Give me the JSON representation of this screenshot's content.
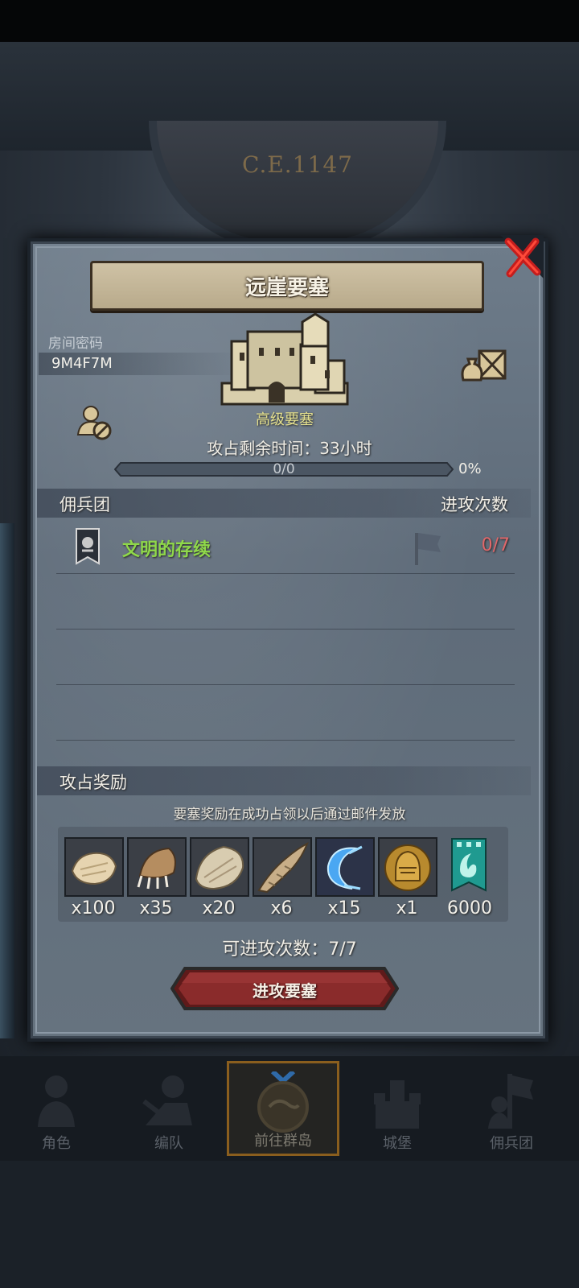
{
  "background": {
    "era_label": "C.E.1147"
  },
  "dialog": {
    "title": "远崖要塞",
    "room_code_label": "房间密码",
    "room_code": "9M4F7M",
    "fortress_grade": "高级要塞",
    "time_remaining": "攻占剩余时间：33小时",
    "progress_value": "0/0",
    "progress_percent": "0%",
    "progress_fraction": 0,
    "mercenary_header": "佣兵团",
    "attack_count_header": "进攻次数",
    "mercenaries": [
      {
        "name": "文明的存续",
        "attacks": "0/7"
      }
    ],
    "rewards_header": "攻占奖励",
    "rewards_note": "要塞奖励在成功占领以后通过邮件发放",
    "rewards": [
      {
        "icon": "fur-icon",
        "qty": "x100"
      },
      {
        "icon": "claw-icon",
        "qty": "x35"
      },
      {
        "icon": "hide-icon",
        "qty": "x20"
      },
      {
        "icon": "horn-icon",
        "qty": "x6"
      },
      {
        "icon": "crescent-icon",
        "qty": "x15"
      },
      {
        "icon": "helmet-icon",
        "qty": "x1"
      },
      {
        "icon": "banner-icon",
        "qty": "6000"
      }
    ],
    "attempts_text": "可进攻次数：7/7",
    "attack_button": "进攻要塞"
  },
  "nav": {
    "items": [
      {
        "label": "角色"
      },
      {
        "label": "编队"
      },
      {
        "label": "前往群岛"
      },
      {
        "label": "城堡"
      },
      {
        "label": "佣兵团"
      }
    ]
  },
  "colors": {
    "accent_green": "#8fd84a",
    "attack_red": "#e0676a",
    "button_red": "#7a2424",
    "grade_yellow": "#e4e08e"
  }
}
